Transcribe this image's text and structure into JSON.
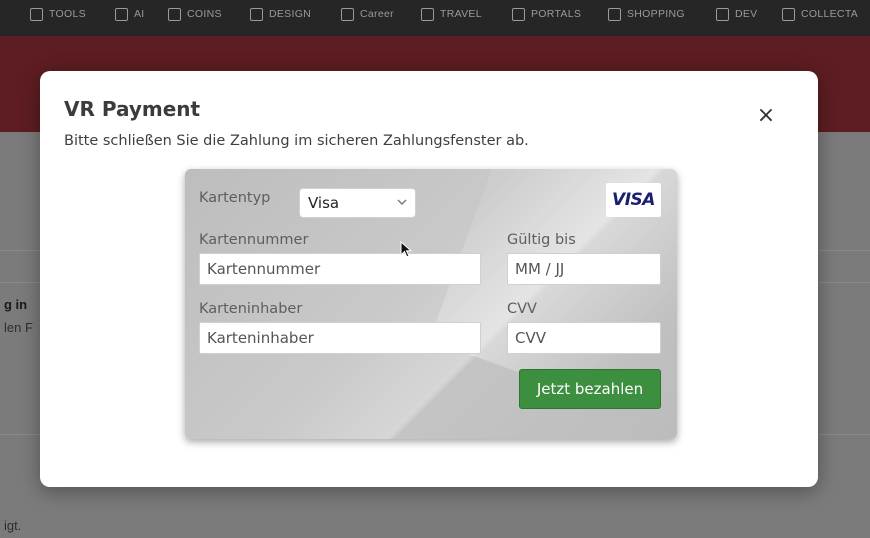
{
  "bookmarks": [
    {
      "label": "TOOLS"
    },
    {
      "label": "AI"
    },
    {
      "label": "COINS"
    },
    {
      "label": "DESIGN"
    },
    {
      "label": "Career"
    },
    {
      "label": "TRAVEL"
    },
    {
      "label": "PORTALS"
    },
    {
      "label": "SHOPPING"
    },
    {
      "label": "DEV"
    },
    {
      "label": "COLLECTA"
    }
  ],
  "background": {
    "snippet_1": "g in",
    "snippet_2": "len F",
    "snippet_3": "igt."
  },
  "modal": {
    "title": "VR Payment",
    "subtitle": "Bitte schließen Sie die Zahlung im sicheren Zahlungsfenster ab.",
    "close_label": "×"
  },
  "card": {
    "card_type_label": "Kartentyp",
    "card_type_value": "Visa",
    "card_logo": "VISA",
    "card_number_label": "Kartennummer",
    "card_number_placeholder": "Kartennummer",
    "expiry_label": "Gültig bis",
    "expiry_placeholder": "MM / JJ",
    "holder_label": "Karteninhaber",
    "holder_placeholder": "Karteninhaber",
    "cvv_label": "CVV",
    "cvv_placeholder": "CVV",
    "pay_button": "Jetzt bezahlen"
  },
  "colors": {
    "header_bg": "#5d1d22",
    "pay_button": "#3c8f3f",
    "visa_blue": "#1a1f71"
  },
  "icons": {
    "close": "close-icon",
    "select_chevron": "chevron-down-icon",
    "pointer": "mouse-cursor-icon"
  }
}
